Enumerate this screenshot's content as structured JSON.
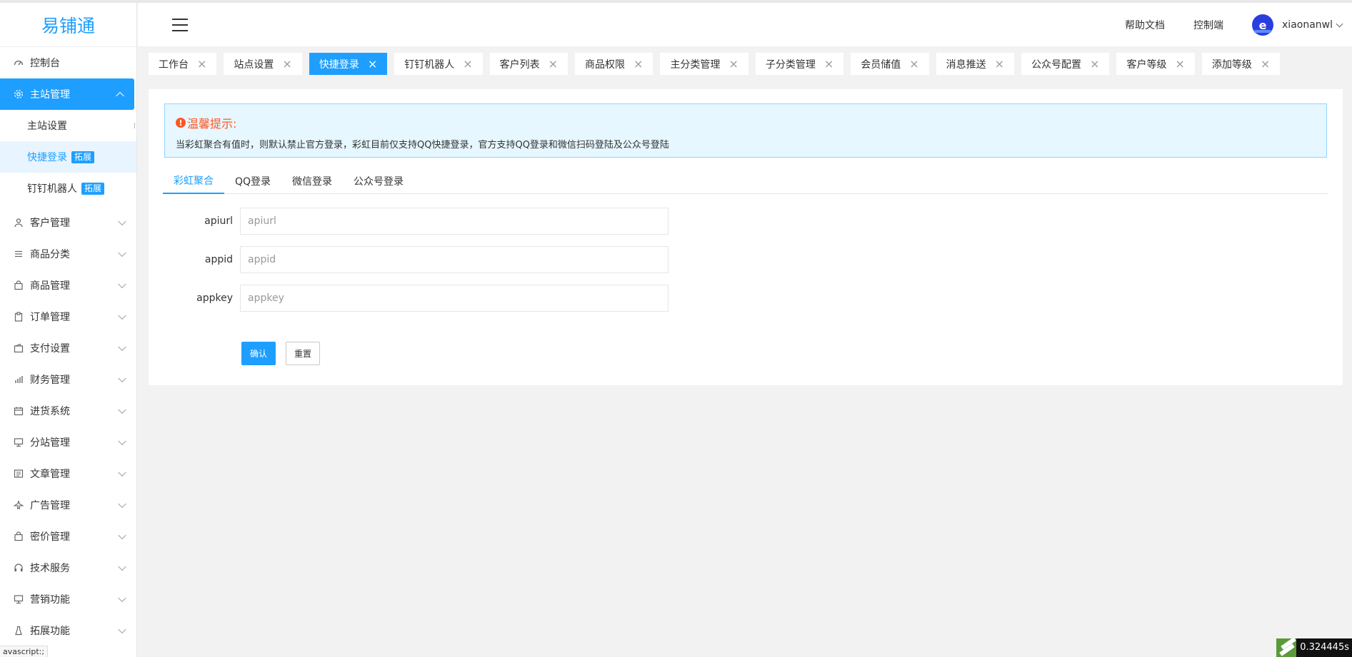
{
  "app": {
    "logo": "易铺通"
  },
  "header": {
    "links": [
      "帮助文档",
      "控制端"
    ],
    "avatar_glyph": "e",
    "username": "xiaonanwl"
  },
  "sidebar": {
    "dashboard": {
      "label": "控制台",
      "icon": "dashboard-icon"
    },
    "active_group": {
      "label": "主站管理",
      "icon": "gear-icon"
    },
    "sub_items": [
      {
        "label": "主站设置",
        "badge": ""
      },
      {
        "label": "快捷登录",
        "badge": "拓展"
      },
      {
        "label": "钉钉机器人",
        "badge": "拓展"
      }
    ],
    "groups": [
      {
        "label": "客户管理",
        "icon": "user-icon"
      },
      {
        "label": "商品分类",
        "icon": "list-icon"
      },
      {
        "label": "商品管理",
        "icon": "bag-icon"
      },
      {
        "label": "订单管理",
        "icon": "clipboard-icon"
      },
      {
        "label": "支付设置",
        "icon": "wallet-icon"
      },
      {
        "label": "财务管理",
        "icon": "bar-chart-icon"
      },
      {
        "label": "进货系统",
        "icon": "calendar-icon"
      },
      {
        "label": "分站管理",
        "icon": "monitor-icon"
      },
      {
        "label": "文章管理",
        "icon": "document-icon"
      },
      {
        "label": "广告管理",
        "icon": "plane-icon"
      },
      {
        "label": "密价管理",
        "icon": "bag-icon"
      },
      {
        "label": "技术服务",
        "icon": "headset-icon"
      },
      {
        "label": "营销功能",
        "icon": "monitor-icon"
      },
      {
        "label": "拓展功能",
        "icon": "bottle-icon"
      }
    ]
  },
  "tabs": [
    {
      "label": "工作台",
      "active": false
    },
    {
      "label": "站点设置",
      "active": false
    },
    {
      "label": "快捷登录",
      "active": true
    },
    {
      "label": "钉钉机器人",
      "active": false
    },
    {
      "label": "客户列表",
      "active": false
    },
    {
      "label": "商品权限",
      "active": false
    },
    {
      "label": "主分类管理",
      "active": false
    },
    {
      "label": "子分类管理",
      "active": false
    },
    {
      "label": "会员储值",
      "active": false
    },
    {
      "label": "消息推送",
      "active": false
    },
    {
      "label": "公众号配置",
      "active": false
    },
    {
      "label": "客户等级",
      "active": false
    },
    {
      "label": "添加等级",
      "active": false
    }
  ],
  "notice": {
    "title": "温馨提示:",
    "text": "当彩虹聚合有值时，则默认禁止官方登录，彩虹目前仅支持QQ快捷登录，官方支持QQ登录和微信扫码登陆及公众号登陆"
  },
  "subtabs": [
    "彩虹聚合",
    "QQ登录",
    "微信登录",
    "公众号登录"
  ],
  "form": {
    "fields": [
      {
        "label": "apiurl",
        "placeholder": "apiurl",
        "value": ""
      },
      {
        "label": "appid",
        "placeholder": "appid",
        "value": ""
      },
      {
        "label": "appkey",
        "placeholder": "appkey",
        "value": ""
      }
    ],
    "confirm_label": "确认",
    "reset_label": "重置"
  },
  "status": {
    "statusbar_text": "avascript:;",
    "timer": "0.324445s"
  },
  "colors": {
    "accent": "#1e9fff",
    "warning": "#ff5722",
    "notice_bg": "#e6f7ff"
  }
}
